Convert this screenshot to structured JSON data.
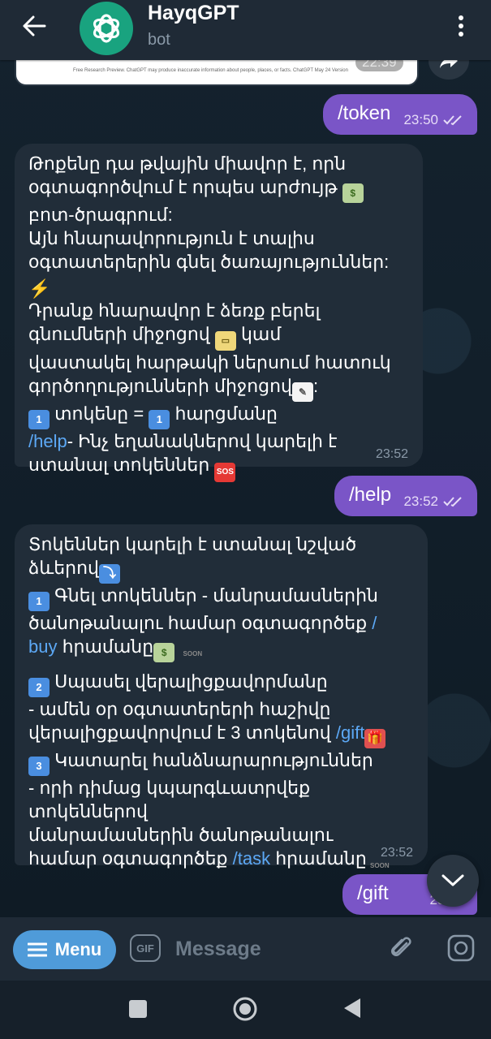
{
  "header": {
    "back_icon": "arrow-left-icon",
    "avatar_icon": "openai-logo-icon",
    "title": "HayqGPT",
    "subtitle": "bot",
    "more_icon": "more-vertical-icon"
  },
  "previous_message": {
    "fine_print": "Free Research Preview. ChatGPT may produce inaccurate information about people, places, or facts. ChatGPT May 24 Version",
    "time": "22:39",
    "forward_icon": "forward-arrow-icon"
  },
  "messages": [
    {
      "direction": "out",
      "text": "/token",
      "time": "23:50",
      "status": "read"
    },
    {
      "direction": "in",
      "lines": {
        "l1": "Թոքենը դա  թվային միավոր է, որն",
        "l2a": "օգտագործվում է որպես արժույթ ",
        "l3": "բոտ-ծրագրում:",
        "l4": "Այն հնարավորություն է տալիս",
        "l5": "օգտատերերին գնել ծառայություններ:",
        "l6": "Դրանք հնարավոր է  ձեռք բերել",
        "l7a": "գնումների միջոցով ",
        "l7b": " կամ",
        "l8": "վաստակել հարթակի ներսում հատուկ",
        "l9a": "գործողությունների միջոցով",
        "l9b": ":",
        "l10a": " տոկենը = ",
        "l10b": " հարցմանը",
        "l11cmd": "/help",
        "l11": "- Ինչ եղանակներով կարելի է",
        "l12": "ստանալ տոկեններ "
      },
      "time": "23:52"
    },
    {
      "direction": "out",
      "text": "/help",
      "time": "23:52",
      "status": "read"
    },
    {
      "direction": "in",
      "lines": {
        "l1": "Տոկեններ կարելի է ստանալ  նշված",
        "l2": "ձևերով",
        "l3": " Գնել տոկեններ - մանրամասներին",
        "l4a": "ծանոթանալու համար օգտագործեք ",
        "l4cmd": "/",
        "l5cmd": "buy",
        "l5": " հրամանը",
        "l6": " Սպասել վերալիցքավորմանը",
        "l7": "- ամեն օր օգտատերերի հաշիվը",
        "l8a": "վերալիցքավորվում է 3 տոկենով ",
        "l8cmd": "/gift",
        "l9": " Կատարել հանձնարարություններ",
        "l10": "- որի դիմաց կպարգևատրվեք",
        "l11": "տոկեններով",
        "l12": "մանրամասներին ծանոթանալու",
        "l13a": "համար օգտագործեք ",
        "l13cmd": "/task",
        "l13b": " հրամանը"
      },
      "time": "23:52"
    },
    {
      "direction": "out",
      "text": "/gift",
      "time": "23:52",
      "status": "sent"
    }
  ],
  "emoji": {
    "money": "$",
    "bolt": "⚡",
    "card": "▭",
    "memo": "✎",
    "one": "1",
    "two": "2",
    "three": "3",
    "sos": "SOS",
    "down": "⤵",
    "gift": "🎁",
    "soon": "SOON"
  },
  "scroll_down_icon": "chevron-down-icon",
  "input_bar": {
    "menu_label": "Menu",
    "gif_label": "GIF",
    "placeholder": "Message",
    "attach_icon": "paperclip-icon",
    "camera_icon": "camera-icon"
  },
  "nav": {
    "recents_icon": "square-icon",
    "home_icon": "circle-icon",
    "back_icon": "triangle-back-icon"
  },
  "colors": {
    "header_bg": "#1f2a36",
    "outgoing_bubble": "#7a55c7",
    "incoming_bubble": "#212d39",
    "link": "#5ca8f5",
    "menu_button": "#4f9bd9"
  }
}
